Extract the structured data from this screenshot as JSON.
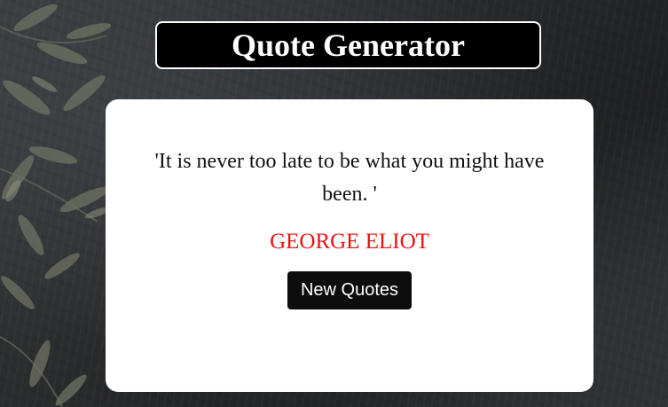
{
  "header": {
    "title": "Quote Generator"
  },
  "quote_card": {
    "quote_text": "'It is never too late to be what you might have been. '",
    "author": "GEORGE ELIOT",
    "button_label": "New Quotes"
  },
  "colors": {
    "title_background": "#000000",
    "card_background": "#ffffff",
    "author_color": "#ee1111",
    "button_background": "#0d0d0d"
  },
  "background": {
    "description_icon": "olive-leaves-icon"
  }
}
